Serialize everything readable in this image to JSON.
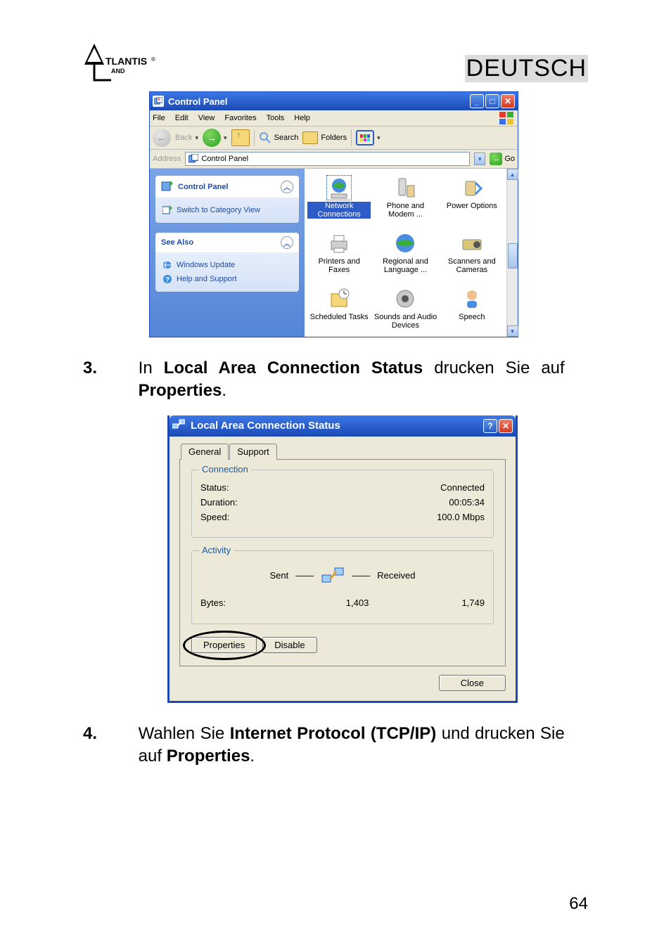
{
  "header": {
    "lang_label": "DEUTSCH",
    "logo_text": "TLANTIS",
    "logo_sub": "AND"
  },
  "cp_window": {
    "title": "Control Panel",
    "menu": [
      "File",
      "Edit",
      "View",
      "Favorites",
      "Tools",
      "Help"
    ],
    "toolbar": {
      "back": "Back",
      "search": "Search",
      "folders": "Folders"
    },
    "address": {
      "label": "Address",
      "value": "Control Panel",
      "go": "Go"
    },
    "sidebar": {
      "panel1": {
        "title": "Control Panel",
        "switch_link": "Switch to Category View"
      },
      "panel2": {
        "title": "See Also",
        "links": [
          "Windows Update",
          "Help and Support"
        ]
      }
    },
    "items": [
      {
        "label": "Network Connections",
        "selected": true
      },
      {
        "label": "Phone and Modem ...",
        "selected": false
      },
      {
        "label": "Power Options",
        "selected": false
      },
      {
        "label": "Printers and Faxes",
        "selected": false
      },
      {
        "label": "Regional and Language ...",
        "selected": false
      },
      {
        "label": "Scanners and Cameras",
        "selected": false
      },
      {
        "label": "Scheduled Tasks",
        "selected": false
      },
      {
        "label": "Sounds and Audio Devices",
        "selected": false
      },
      {
        "label": "Speech",
        "selected": false
      }
    ]
  },
  "step3": {
    "num": "3.",
    "pre": "In ",
    "bold1": "Local Area Connection Status",
    "mid": " drucken Sie auf ",
    "bold2": "Properties",
    "post": "."
  },
  "dialog": {
    "title": "Local Area Connection Status",
    "tabs": [
      "General",
      "Support"
    ],
    "group_connection": {
      "legend": "Connection",
      "rows": [
        {
          "k": "Status:",
          "v": "Connected"
        },
        {
          "k": "Duration:",
          "v": "00:05:34"
        },
        {
          "k": "Speed:",
          "v": "100.0 Mbps"
        }
      ]
    },
    "group_activity": {
      "legend": "Activity",
      "sent": "Sent",
      "received": "Received",
      "bytes_label": "Bytes:",
      "bytes_sent": "1,403",
      "bytes_received": "1,749"
    },
    "buttons": {
      "properties": "Properties",
      "disable": "Disable",
      "close": "Close"
    }
  },
  "step4": {
    "num": "4.",
    "pre": "Wahlen Sie ",
    "bold1": "Internet Protocol (TCP/IP)",
    "mid": " und drucken Sie auf  ",
    "bold2": "Properties",
    "post": "."
  },
  "pagenum": "64"
}
